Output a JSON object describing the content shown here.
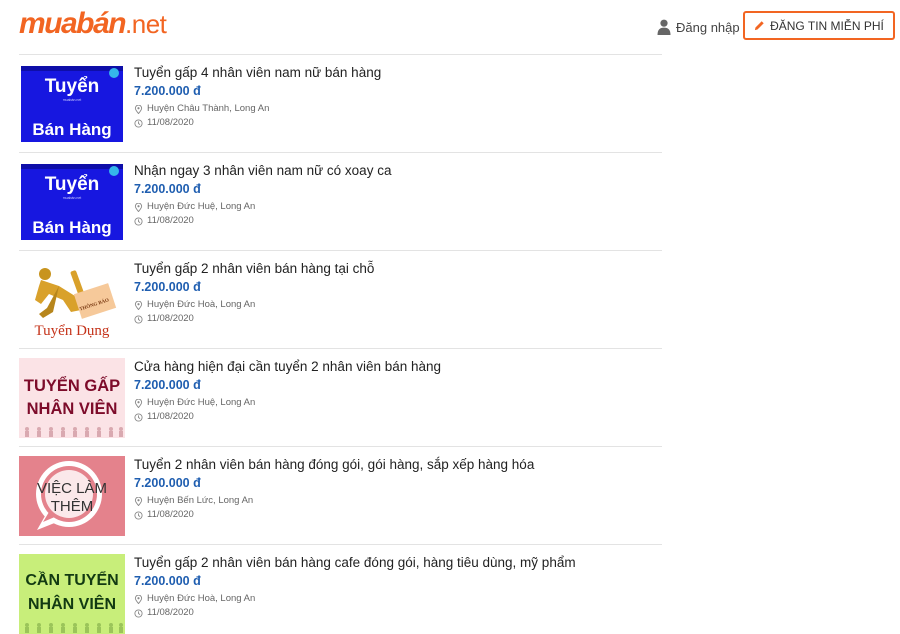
{
  "header": {
    "logo_brand": "muabán",
    "logo_tld": ".net",
    "login_label": "Đăng nhập",
    "post_button_label": "ĐĂNG TIN MIỄN PHÍ",
    "accent_color": "#f26522"
  },
  "listings": [
    {
      "title": "Tuyển gấp 4 nhân viên nam nữ bán hàng",
      "price": "7.200.000 đ",
      "location": "Huyện Châu Thành, Long An",
      "date": "11/08/2020",
      "thumb_line1": "Tuyển",
      "thumb_line2": "Bán Hàng",
      "thumb_brand": "muabán.net"
    },
    {
      "title": "Nhận ngay 3 nhân viên nam nữ có xoay ca",
      "price": "7.200.000 đ",
      "location": "Huyện Đức Huệ, Long An",
      "date": "11/08/2020",
      "thumb_line1": "Tuyển",
      "thumb_line2": "Bán Hàng",
      "thumb_brand": "muabán.net"
    },
    {
      "title": "Tuyển gấp 2 nhân viên bán hàng tại chỗ",
      "price": "7.200.000 đ",
      "location": "Huyện Đức Hoà, Long An",
      "date": "11/08/2020",
      "thumb_line1": "THÔNG BÁO",
      "thumb_line2": "Tuyển Dụng"
    },
    {
      "title": "Cửa hàng hiện đại cần tuyển 2 nhân viên bán hàng",
      "price": "7.200.000 đ",
      "location": "Huyện Đức Huệ, Long An",
      "date": "11/08/2020",
      "thumb_line1": "TUYỂN GẤP",
      "thumb_line2": "NHÂN VIÊN"
    },
    {
      "title": "Tuyển 2 nhân viên bán hàng đóng gói, gói hàng, sắp xếp hàng hóa",
      "price": "7.200.000 đ",
      "location": "Huyện Bến Lức, Long An",
      "date": "11/08/2020",
      "thumb_line1": "VIỆC LÀM",
      "thumb_line2": "THÊM"
    },
    {
      "title": "Tuyển gấp 2 nhân viên bán hàng cafe đóng gói, hàng tiêu dùng, mỹ phẩm",
      "price": "7.200.000 đ",
      "location": "Huyện Đức Hoà, Long An",
      "date": "11/08/2020",
      "thumb_line1": "CẦN TUYỂN",
      "thumb_line2": "NHÂN VIÊN"
    }
  ],
  "icons": {
    "login": "user-icon",
    "post": "pencil-icon",
    "location": "map-pin-icon",
    "date": "clock-icon"
  }
}
